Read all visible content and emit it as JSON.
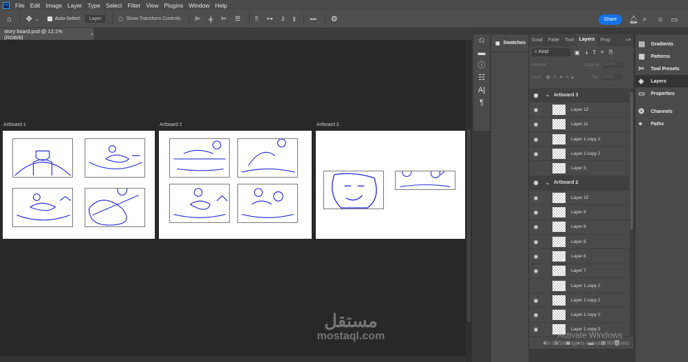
{
  "app": {
    "logo": "Ps"
  },
  "menu": [
    "File",
    "Edit",
    "Image",
    "Layer",
    "Type",
    "Select",
    "Filter",
    "View",
    "Plugins",
    "Window",
    "Help"
  ],
  "options": {
    "auto_select_label": "Auto-Select:",
    "auto_select_value": "Layer",
    "show_transform_label": "Show Transform Controls",
    "more": "•••"
  },
  "header": {
    "share_label": "Share"
  },
  "document": {
    "tab_title": "story board.psd @ 12.1% (RGB/8)",
    "close": "×"
  },
  "artboards": [
    {
      "name": "Artboard 1"
    },
    {
      "name": "Artboard 2"
    },
    {
      "name": "Artboard 3"
    }
  ],
  "swatches": {
    "label": "Swatches"
  },
  "layers_panel": {
    "tabs": [
      "Grad",
      "Patte",
      "Tool",
      "Layers",
      "Prop"
    ],
    "kind_label": "Kind",
    "blend_mode": "Normal",
    "opacity_label": "Opacity:",
    "opacity_value": "100%",
    "lock_label": "Lock:",
    "fill_label": "Fill:",
    "fill_value": "100%",
    "layers": [
      {
        "name": "Artboard 3",
        "type": "artboard",
        "visible": true
      },
      {
        "name": "Layer 12",
        "visible": true
      },
      {
        "name": "Layer 11",
        "visible": true
      },
      {
        "name": "Layer 1 copy 2",
        "visible": true
      },
      {
        "name": "Layer 1 copy 2",
        "visible": true
      },
      {
        "name": "Layer 5",
        "visible": false
      },
      {
        "name": "Artboard 2",
        "type": "artboard",
        "visible": true
      },
      {
        "name": "Layer 10",
        "visible": true
      },
      {
        "name": "Layer 9",
        "visible": true
      },
      {
        "name": "Layer 9",
        "visible": true
      },
      {
        "name": "Layer 8",
        "visible": true
      },
      {
        "name": "Layer 6",
        "visible": true
      },
      {
        "name": "Layer 7",
        "visible": true
      },
      {
        "name": "Layer 1 copy 2",
        "visible": false
      },
      {
        "name": "Layer 1 copy 2",
        "visible": true
      },
      {
        "name": "Layer 1 copy 2",
        "visible": true
      },
      {
        "name": "Layer 1 copy 2",
        "visible": true
      }
    ]
  },
  "right_dock": [
    "Gradients",
    "Patterns",
    "Tool Presets",
    "Layers",
    "Properties",
    "Channels",
    "Paths"
  ],
  "overlay": {
    "watermark_arabic": "مستقل",
    "watermark_latin": "mostaql.com",
    "activate_title": "Activate Windows",
    "activate_sub": "Go to Settings to activate Windows."
  }
}
